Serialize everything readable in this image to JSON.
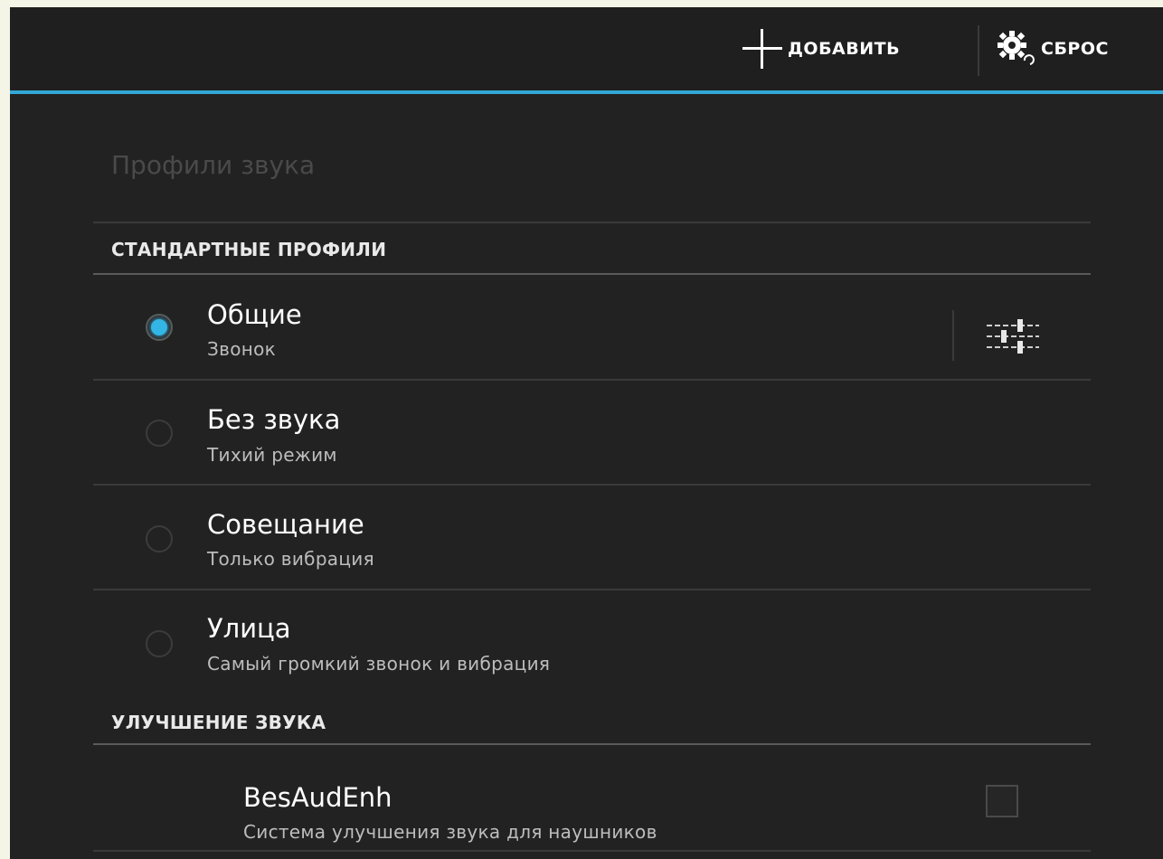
{
  "actionbar": {
    "add_label": "ДОБАВИТЬ",
    "reset_label": "СБРОС",
    "accent_color": "#33a7d6",
    "add_icon": "plus-icon",
    "reset_icon": "gear-reset-icon"
  },
  "page": {
    "title": "Профили звука"
  },
  "standard_profiles": {
    "header": "СТАНДАРТНЫЕ ПРОФИЛИ",
    "selected_index": 0,
    "items": [
      {
        "title": "Общие",
        "subtitle": "Звонок",
        "checked": true
      },
      {
        "title": "Без звука",
        "subtitle": "Тихий режим",
        "checked": false
      },
      {
        "title": "Совещание",
        "subtitle": "Только вибрация",
        "checked": false
      },
      {
        "title": "Улица",
        "subtitle": "Самый громкий звонок и вибрация",
        "checked": false
      }
    ],
    "settings_icon": "sliders-icon"
  },
  "sound_enhancement": {
    "header": "УЛУЧШЕНИЕ ЗВУКА",
    "items": [
      {
        "title": "BesAudEnh",
        "subtitle": "Система улучшения звука для наушников",
        "checked": false
      }
    ]
  }
}
